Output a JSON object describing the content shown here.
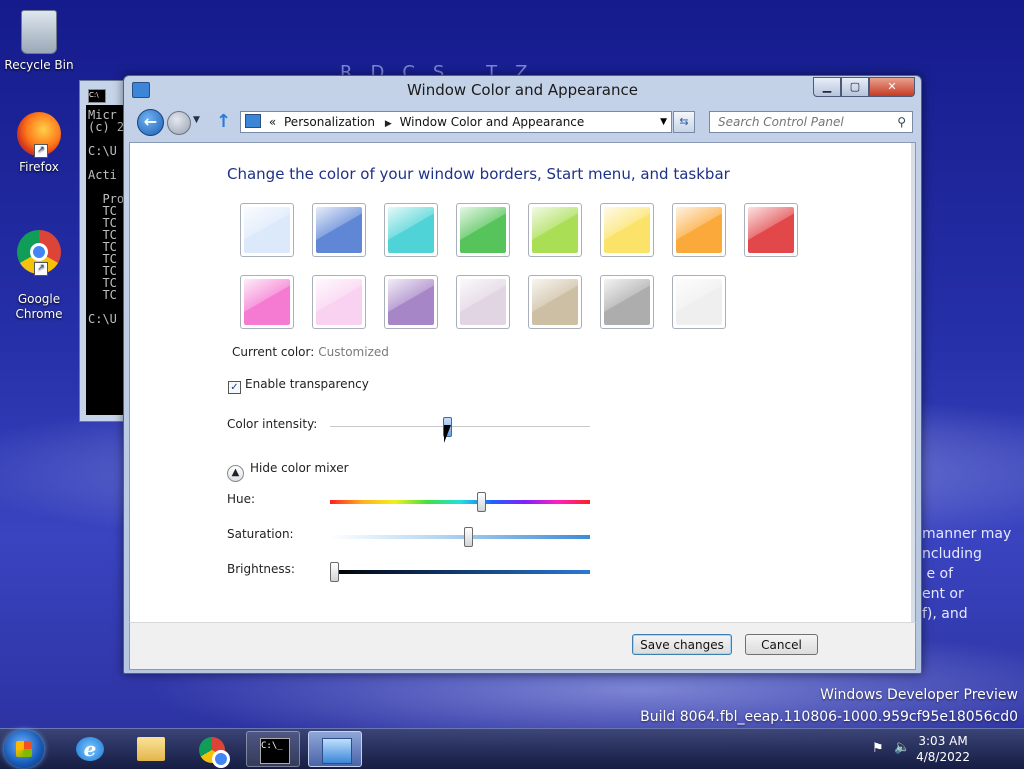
{
  "desktop": {
    "icons": [
      {
        "label": "Recycle Bin"
      },
      {
        "label": "Firefox"
      },
      {
        "label": "Google\nChrome"
      }
    ],
    "watermark_line1": "Windows Developer Preview",
    "watermark_line2": "Build 8064.fbl_eeap.110806-1000.959cf95e18056cd0",
    "background_text": "manner may\nncluding\n e of\nent or\nf), and"
  },
  "console": {
    "lines": "Micr\n(c) 2\n\nC:\\U\n\nActi\n\n  Pro\n  TC\n  TC\n  TC\n  TC\n  TC\n  TC\n  TC\n  TC\n\nC:\\U"
  },
  "window": {
    "title": "Window Color and Appearance",
    "address": {
      "prefix": "«",
      "segments": [
        "Personalization",
        "Window Color and Appearance"
      ]
    },
    "search_placeholder": "Search Control Panel",
    "heading": "Change the color of your window borders, Start menu, and taskbar",
    "swatches": [
      {
        "name": "sky",
        "color": "#dce9fb"
      },
      {
        "name": "twilight",
        "color": "#5f87d6"
      },
      {
        "name": "sea",
        "color": "#4fd3d6"
      },
      {
        "name": "leaf",
        "color": "#56c45a"
      },
      {
        "name": "lime",
        "color": "#a9de55"
      },
      {
        "name": "lemon",
        "color": "#fbe36a"
      },
      {
        "name": "pumpkin",
        "color": "#fba93a"
      },
      {
        "name": "ruby",
        "color": "#e2484a"
      },
      {
        "name": "fuchsia",
        "color": "#f57bd2"
      },
      {
        "name": "blush",
        "color": "#fad2f1"
      },
      {
        "name": "violet",
        "color": "#a786c8"
      },
      {
        "name": "lavender",
        "color": "#e2d5e3"
      },
      {
        "name": "taupe",
        "color": "#cdbfa3"
      },
      {
        "name": "chocolate",
        "color": "#adadad"
      },
      {
        "name": "frost",
        "color": "#efefef"
      }
    ],
    "current_color_label": "Current color:",
    "current_color_value": "Customized",
    "transparency_label": "Enable transparency",
    "transparency_checked": true,
    "intensity_label": "Color intensity:",
    "intensity_value": 0.45,
    "mixer_toggle_label": "Hide color mixer",
    "hue_label": "Hue:",
    "hue_value": 0.58,
    "saturation_label": "Saturation:",
    "saturation_value": 0.53,
    "brightness_label": "Brightness:",
    "brightness_value": 0.0,
    "save_label": "Save changes",
    "cancel_label": "Cancel"
  },
  "taskbar": {
    "time": "3:03 AM",
    "date": "4/8/2022",
    "console_glyph": "C:\\_"
  }
}
